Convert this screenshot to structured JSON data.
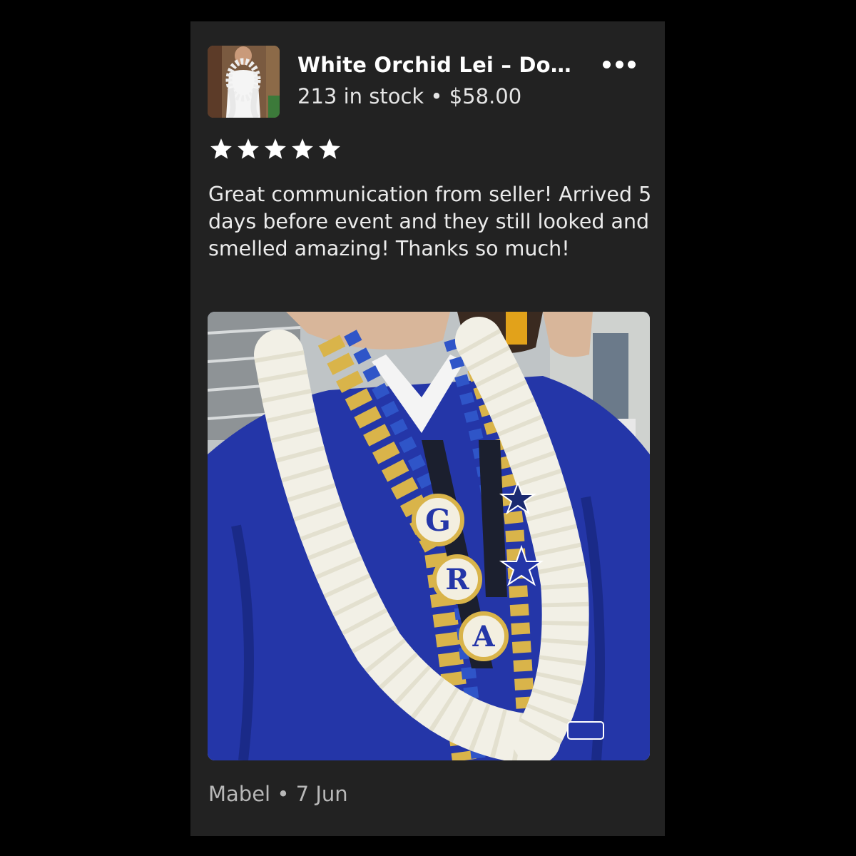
{
  "product": {
    "title": "White Orchid Lei – Dou...",
    "stock_text": "213 in stock",
    "separator": "•",
    "price": "$58.00"
  },
  "rating": {
    "stars": 5,
    "max": 5
  },
  "review": {
    "text": "Great communication from seller! Arrived 5 days before event and they still looked and smelled amazing! Thanks so much!"
  },
  "photo": {
    "patch_letters": [
      "G",
      "R",
      "A"
    ]
  },
  "footer": {
    "author": "Mabel",
    "separator": "•",
    "date": "7 Jun"
  },
  "colors": {
    "card_bg": "#222222",
    "page_bg": "#000000",
    "gown_blue": "#2436a8",
    "lei_white": "#f2f0e6"
  },
  "icons": {
    "more": "more-horizontal-icon",
    "star": "star-icon"
  }
}
